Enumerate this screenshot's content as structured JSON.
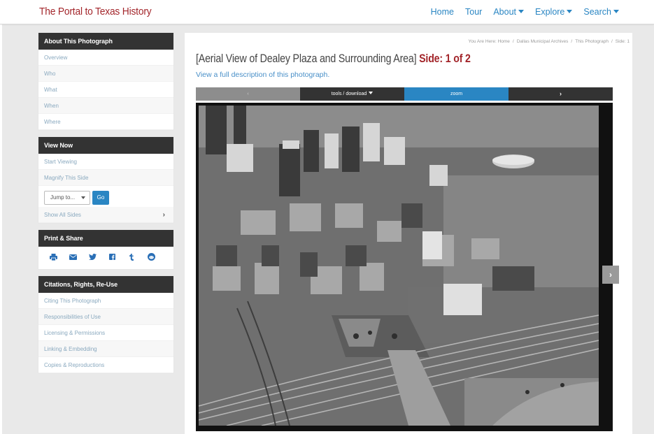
{
  "brand": "The Portal to Texas History",
  "nav": {
    "home": "Home",
    "tour": "Tour",
    "about": "About",
    "explore": "Explore",
    "search": "Search"
  },
  "sidebar": {
    "about_panel": {
      "title": "About This Photograph",
      "items": [
        "Overview",
        "Who",
        "What",
        "When",
        "Where"
      ]
    },
    "view_panel": {
      "title": "View Now",
      "start": "Start Viewing",
      "magnify": "Magnify This Side",
      "jump_placeholder": "Jump to...",
      "go": "Go",
      "show_all": "Show All Sides",
      "show_all_chevron": "›"
    },
    "share_panel": {
      "title": "Print & Share",
      "icons": [
        "print-icon",
        "email-icon",
        "twitter-icon",
        "facebook-icon",
        "tumblr-icon",
        "reddit-icon"
      ]
    },
    "citations_panel": {
      "title": "Citations, Rights, Re-Use",
      "items": [
        "Citing This Photograph",
        "Responsibilities of Use",
        "Licensing & Permissions",
        "Linking & Embedding",
        "Copies & Reproductions"
      ]
    }
  },
  "breadcrumb": {
    "prefix": "You Are Here:",
    "home": "Home",
    "archives": "Dallas Municipal Archives",
    "photo": "This Photograph",
    "side": "Side: 1"
  },
  "title": {
    "main": "[Aerial View of Dealey Plaza and Surrounding Area]",
    "side": "Side: 1 of 2"
  },
  "full_description": "View a full description of this photograph.",
  "toolbar": {
    "prev": "‹",
    "tools": "tools / download",
    "zoom": "zoom",
    "next": "›"
  },
  "next_arrow": "›",
  "colors": {
    "brand_red": "#a3262b",
    "link_blue": "#2a86c3",
    "panel_dark": "#333333"
  }
}
